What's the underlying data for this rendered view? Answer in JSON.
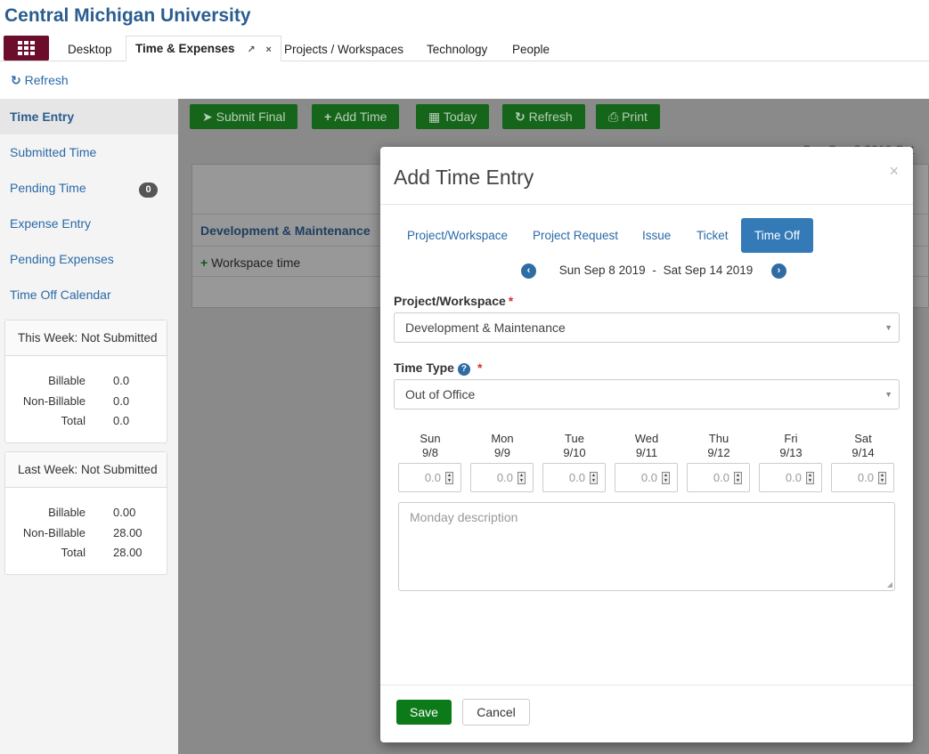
{
  "header": {
    "title": "Central Michigan University"
  },
  "tabs": {
    "desktop": "Desktop",
    "time_expenses": "Time & Expenses",
    "pin_icon": "↗",
    "close_icon": "×",
    "projects": "Projects / Workspaces",
    "technology": "Technology",
    "people": "People"
  },
  "toolbar_top": {
    "refresh": "Refresh"
  },
  "sidebar": {
    "items": [
      {
        "label": "Time Entry"
      },
      {
        "label": "Submitted Time"
      },
      {
        "label": "Pending Time"
      },
      {
        "label": "Expense Entry"
      },
      {
        "label": "Pending Expenses"
      },
      {
        "label": "Time Off Calendar"
      }
    ],
    "pending_badge": "0",
    "this_week": {
      "title": "This Week: Not Submitted",
      "rows": [
        {
          "label": "Billable",
          "value": "0.0"
        },
        {
          "label": "Non-Billable",
          "value": "0.0"
        },
        {
          "label": "Total",
          "value": "0.0"
        }
      ]
    },
    "last_week": {
      "title": "Last Week: Not Submitted",
      "rows": [
        {
          "label": "Billable",
          "value": "0.00"
        },
        {
          "label": "Non-Billable",
          "value": "28.00"
        },
        {
          "label": "Total",
          "value": "28.00"
        }
      ]
    }
  },
  "main_toolbar": {
    "submit_final": "Submit Final",
    "add_time": "Add Time",
    "today": "Today",
    "refresh": "Refresh",
    "print": "Print"
  },
  "grid": {
    "date_peek": "Sun Sep 8 2019    Sat",
    "project_row": "Development & Maintenance",
    "workspace_row": "Workspace time"
  },
  "modal": {
    "title": "Add Time Entry",
    "close": "×",
    "tabs": [
      "Project/Workspace",
      "Project Request",
      "Issue",
      "Ticket",
      "Time Off"
    ],
    "active_tab": "Time Off",
    "week_start": "Sun Sep 8 2019",
    "week_sep": "-",
    "week_end": "Sat Sep 14 2019",
    "project_label": "Project/Workspace",
    "project_value": "Development & Maintenance",
    "time_type_label": "Time Type",
    "time_type_value": "Out of Office",
    "required_mark": "*",
    "days": [
      {
        "name": "Sun",
        "date": "9/8",
        "value": "0.0"
      },
      {
        "name": "Mon",
        "date": "9/9",
        "value": "0.0"
      },
      {
        "name": "Tue",
        "date": "9/10",
        "value": "0.0"
      },
      {
        "name": "Wed",
        "date": "9/11",
        "value": "0.0"
      },
      {
        "name": "Thu",
        "date": "9/12",
        "value": "0.0"
      },
      {
        "name": "Fri",
        "date": "9/13",
        "value": "0.0"
      },
      {
        "name": "Sat",
        "date": "9/14",
        "value": "0.0"
      }
    ],
    "description_placeholder": "Monday description",
    "save": "Save",
    "cancel": "Cancel"
  },
  "colors": {
    "brand": "#2a5d8f",
    "app_button": "#6b0d2b",
    "green": "#0d7a1a",
    "primary": "#337ab7"
  }
}
